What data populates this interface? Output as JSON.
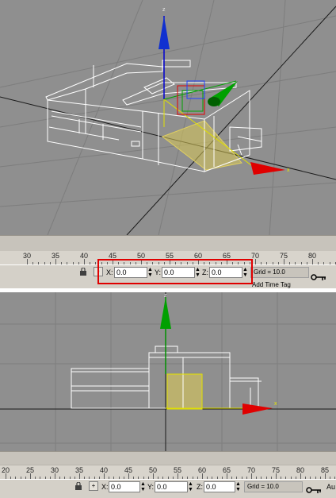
{
  "top": {
    "ruler_numbers": [
      "30",
      "35",
      "40",
      "45",
      "50",
      "55",
      "60",
      "65",
      "70",
      "75",
      "80"
    ],
    "coords": {
      "x_label": "X:",
      "y_label": "Y:",
      "z_label": "Z:",
      "x": "0.0",
      "y": "0.0",
      "z": "0.0"
    },
    "grid_label": "Grid = 10.0",
    "time_tag_label": "Add Time Tag",
    "gizmo_label": "z",
    "x_label": "x",
    "lock_icon": "lock-icon",
    "key_icon": "key-icon",
    "highlight_color": "#e00000"
  },
  "bottom": {
    "ruler_numbers": [
      "20",
      "25",
      "30",
      "35",
      "40",
      "45",
      "50",
      "55",
      "60",
      "65",
      "70",
      "75",
      "80",
      "85"
    ],
    "coords": {
      "x_label": "X:",
      "y_label": "Y:",
      "z_label": "Z:",
      "x": "0.0",
      "y": "0.0",
      "z": "0.0"
    },
    "grid_label": "Grid = 10.0",
    "auto_label": "Au",
    "gizmo_label": "z",
    "x_label": "x",
    "key_icon": "key-icon"
  },
  "colors": {
    "viewport_bg": "#8f8f8f",
    "x_axis": "#e00000",
    "y_axis": "#00a000",
    "z_axis": "#1030d0",
    "selection": "#d8c858"
  }
}
